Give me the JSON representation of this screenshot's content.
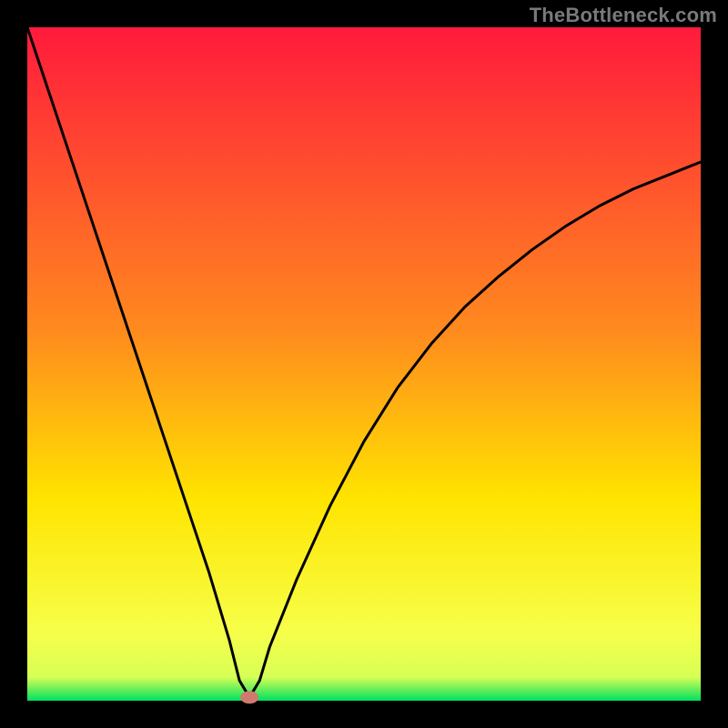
{
  "watermark": "TheBottleneck.com",
  "colors": {
    "gradient_top": "#ff1a3c",
    "gradient_mid1": "#ff8a1e",
    "gradient_mid2": "#ffe400",
    "gradient_low": "#f6ff4a",
    "gradient_green": "#00e060",
    "curve": "#000000",
    "marker": "#cf7a6d",
    "frame": "#000000"
  },
  "chart_data": {
    "type": "line",
    "title": "",
    "xlabel": "",
    "ylabel": "",
    "xlim": [
      0,
      100
    ],
    "ylim": [
      0,
      100
    ],
    "series": [
      {
        "name": "bottleneck-curve",
        "x": [
          0,
          3,
          6,
          9,
          12,
          15,
          18,
          21,
          24,
          27,
          30,
          31.5,
          33,
          34.5,
          36,
          40,
          45,
          50,
          55,
          60,
          65,
          70,
          75,
          80,
          85,
          90,
          95,
          100
        ],
        "y": [
          100,
          91,
          82,
          73,
          64,
          55,
          46,
          37,
          28,
          19,
          9,
          3,
          0.5,
          3,
          8,
          18,
          29,
          38.5,
          46.5,
          53,
          58.5,
          63,
          67,
          70.5,
          73.5,
          76,
          78,
          80
        ]
      }
    ],
    "marker": {
      "x": 33,
      "y": 0.5
    },
    "gradient_stops": [
      {
        "pos": 0.0,
        "color": "#ff1a3c"
      },
      {
        "pos": 0.45,
        "color": "#ff8a1e"
      },
      {
        "pos": 0.7,
        "color": "#ffe400"
      },
      {
        "pos": 0.9,
        "color": "#f6ff4a"
      },
      {
        "pos": 0.965,
        "color": "#d7ff55"
      },
      {
        "pos": 1.0,
        "color": "#00e060"
      }
    ]
  }
}
